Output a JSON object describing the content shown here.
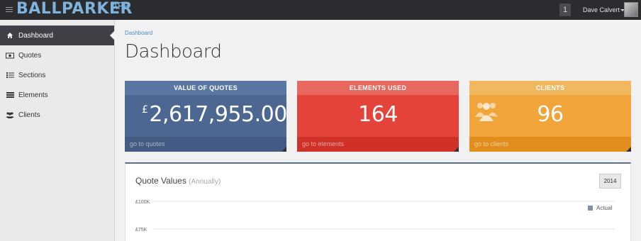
{
  "app": {
    "brand": "BALLPARKER",
    "brand_suffix": "APP"
  },
  "topbar": {
    "notification_count": "1",
    "user_name": "Dave Calvert"
  },
  "sidebar": {
    "items": [
      {
        "label": "Dashboard",
        "icon": "home-icon",
        "active": true
      },
      {
        "label": "Quotes",
        "icon": "money-icon",
        "active": false
      },
      {
        "label": "Sections",
        "icon": "list-icon",
        "active": false
      },
      {
        "label": "Elements",
        "icon": "bars-icon",
        "active": false
      },
      {
        "label": "Clients",
        "icon": "users-icon",
        "active": false
      }
    ]
  },
  "breadcrumb": "Dashboard",
  "page_title": "Dashboard",
  "tiles": {
    "quotes": {
      "title": "VALUE OF QUOTES",
      "currency": "£",
      "value": "2,617,955.00",
      "link": "go to quotes",
      "color": "#4d6793"
    },
    "elements": {
      "title": "ELEMENTS USED",
      "value": "164",
      "link": "go to elements",
      "color": "#e4433a"
    },
    "clients": {
      "title": "CLIENTS",
      "value": "96",
      "link": "go to clients",
      "color": "#f0a43a"
    }
  },
  "chart_panel": {
    "title": "Quote Values",
    "subtitle": "(Annually)",
    "year_button": "2014"
  },
  "chart_data": {
    "type": "line",
    "title": "Quote Values",
    "subtitle": "(Annually)",
    "y_tick_labels": [
      "£100K",
      "£75K"
    ],
    "y_ticks": [
      100000,
      75000
    ],
    "grid": true,
    "legend_position": "top-right",
    "series": [
      {
        "name": "Actual",
        "color": "#8191ad",
        "values": []
      }
    ]
  }
}
